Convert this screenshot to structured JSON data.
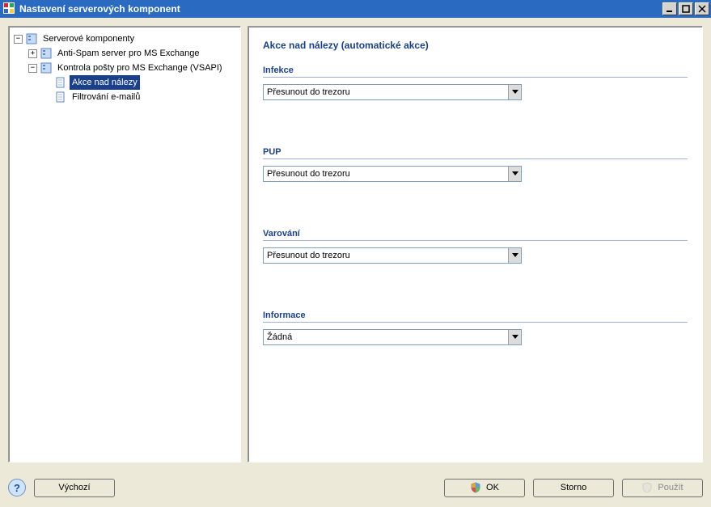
{
  "window": {
    "title": "Nastavení serverových komponent"
  },
  "tree": {
    "root_label": "Serverové komponenty",
    "antispam_label": "Anti-Spam server pro MS Exchange",
    "vsapi_label": "Kontrola pošty pro MS Exchange (VSAPI)",
    "actions_label": "Akce nad nálezy",
    "filter_label": "Filtrování e-mailů"
  },
  "main": {
    "title": "Akce nad nálezy (automatické akce)",
    "groups": {
      "infection": {
        "label": "Infekce",
        "value": "Přesunout do trezoru"
      },
      "pup": {
        "label": "PUP",
        "value": "Přesunout do trezoru"
      },
      "warning": {
        "label": "Varování",
        "value": "Přesunout do trezoru"
      },
      "info": {
        "label": "Informace",
        "value": "Žádná"
      }
    }
  },
  "footer": {
    "default": "Výchozí",
    "ok": "OK",
    "cancel": "Storno",
    "apply": "Použít"
  }
}
